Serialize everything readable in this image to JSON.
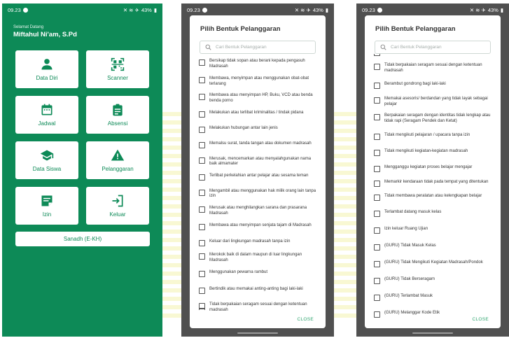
{
  "status": {
    "time": "09.23",
    "battery": "43%"
  },
  "home": {
    "greeting": "Selamat Datang",
    "user_name": "Miftahul Ni'am, S.Pd",
    "tiles": [
      {
        "label": "Data Diri",
        "icon": "person-icon"
      },
      {
        "label": "Scanner",
        "icon": "qr-scanner-icon"
      },
      {
        "label": "Jadwal",
        "icon": "calendar-icon"
      },
      {
        "label": "Absensi",
        "icon": "clipboard-icon"
      },
      {
        "label": "Data Siswa",
        "icon": "graduation-cap-icon"
      },
      {
        "label": "Pelanggaran",
        "icon": "warning-icon"
      },
      {
        "label": "Izin",
        "icon": "note-icon"
      },
      {
        "label": "Keluar",
        "icon": "logout-icon"
      }
    ],
    "wide_button": "Sanadh (E-KH)"
  },
  "dialog1": {
    "title": "Pilih Bentuk Pelanggaran",
    "search_placeholder": "Cari Bentuk Pelanggaran",
    "close": "CLOSE",
    "items": [
      "Bersikap tidak sopan atau berani kepada pengasuh Madrasah",
      "Membawa, menyimpan atau menggunakan obat-obat terlarang",
      "Membawa atau menyimpan HP, Buku, VCD atau benda benda porno",
      "Melakukan atau terlibat kriminalitas / tindak pidana",
      "Melakukan hubungan antar lain jenis",
      "Memalsu surat, tanda tangan atau dokumen madrasah",
      "Merusak, mencemarkan atau menyalahgunakan nama baik almamater",
      "Terlibat perkelahian antar pelajar atau sesama teman",
      "Mengambil atau menggunakan hak milik orang lain tanpa izin",
      "Merusak atau menghilangkan sarana dan prasarana Madrasah",
      "Membawa atau menyimpan senjata tajam di Madrasah",
      "Keluar dari lingkungan madrasah tanpa izin",
      "Merokok baik di dalam maupun di luar lingkungan Madrasah",
      "Menggunakan pewarna rambut",
      "Bertindik atau memakai anting-anting bagi laki-laki",
      "Tidak berpakaian seragam sesuai dengan ketentuan madrasah"
    ]
  },
  "dialog2": {
    "title": "Pilih Bentuk Pelanggaran",
    "search_placeholder": "Cari Bentuk Pelanggaran",
    "close": "CLOSE",
    "items": [
      "Tidak berpakaian seragam sesuai dengan ketentuan madrasah",
      "Berambut gondrong bagi laki-laki",
      "Memakai asesoris/ berdandan yang tidak layak sebagai pelajar",
      "Berpakaian seragam dengan identitas tidak lengkap atau tidak rapi (Seragam Pendek dan Ketat)",
      "Tidak mengikuti pelajaran / upacara tanpa izin",
      "Tidak mengikuti kegiatan-kegiatan madrasah",
      "Mengganggu kegiatan proses belajar mengajar",
      "Memarkir kendaraan tidak pada tempat yang ditentukan",
      "Tidak membawa peralatan atau kelengkapan belajar",
      "Terlambat datang masuk kelas",
      "Izin keluar Ruang Ujian",
      "(GURU) Tidak Masuk Kelas",
      "(GURU) Tidak Mengikuti Kegiatan Madrasah/Pondok",
      "(GURU) Tidak Berseragam",
      "(GURU) Terlambat Masuk",
      "(GURU) Melanggar Kode Etik"
    ]
  },
  "colors": {
    "primary": "#0d8a57",
    "accent": "#2fa56f",
    "overlay": "#505050"
  }
}
